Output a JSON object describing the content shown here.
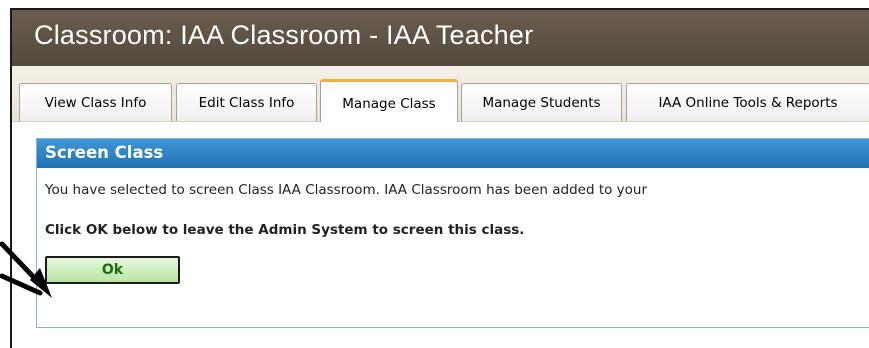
{
  "header": {
    "title": "Classroom: IAA Classroom - IAA Teacher"
  },
  "tabs": [
    {
      "label": "View Class Info",
      "active": false
    },
    {
      "label": "Edit Class Info",
      "active": false
    },
    {
      "label": "Manage Class",
      "active": true
    },
    {
      "label": "Manage Students",
      "active": false
    },
    {
      "label": "IAA Online Tools & Reports",
      "active": false
    }
  ],
  "panel": {
    "title": "Screen Class",
    "message": "You have selected to screen Class IAA Classroom. IAA Classroom has been added to your",
    "instruction": "Click OK below to leave the Admin System to screen this class.",
    "ok_label": "Ok"
  },
  "annotation": {
    "icon": "arrow-pointer-icon",
    "color": "#000000"
  },
  "colors": {
    "titlebar": "#5f5346",
    "panel_header": "#2a83c6",
    "ok_button": "#c8edb6",
    "active_tab_accent": "#f0b43c"
  }
}
